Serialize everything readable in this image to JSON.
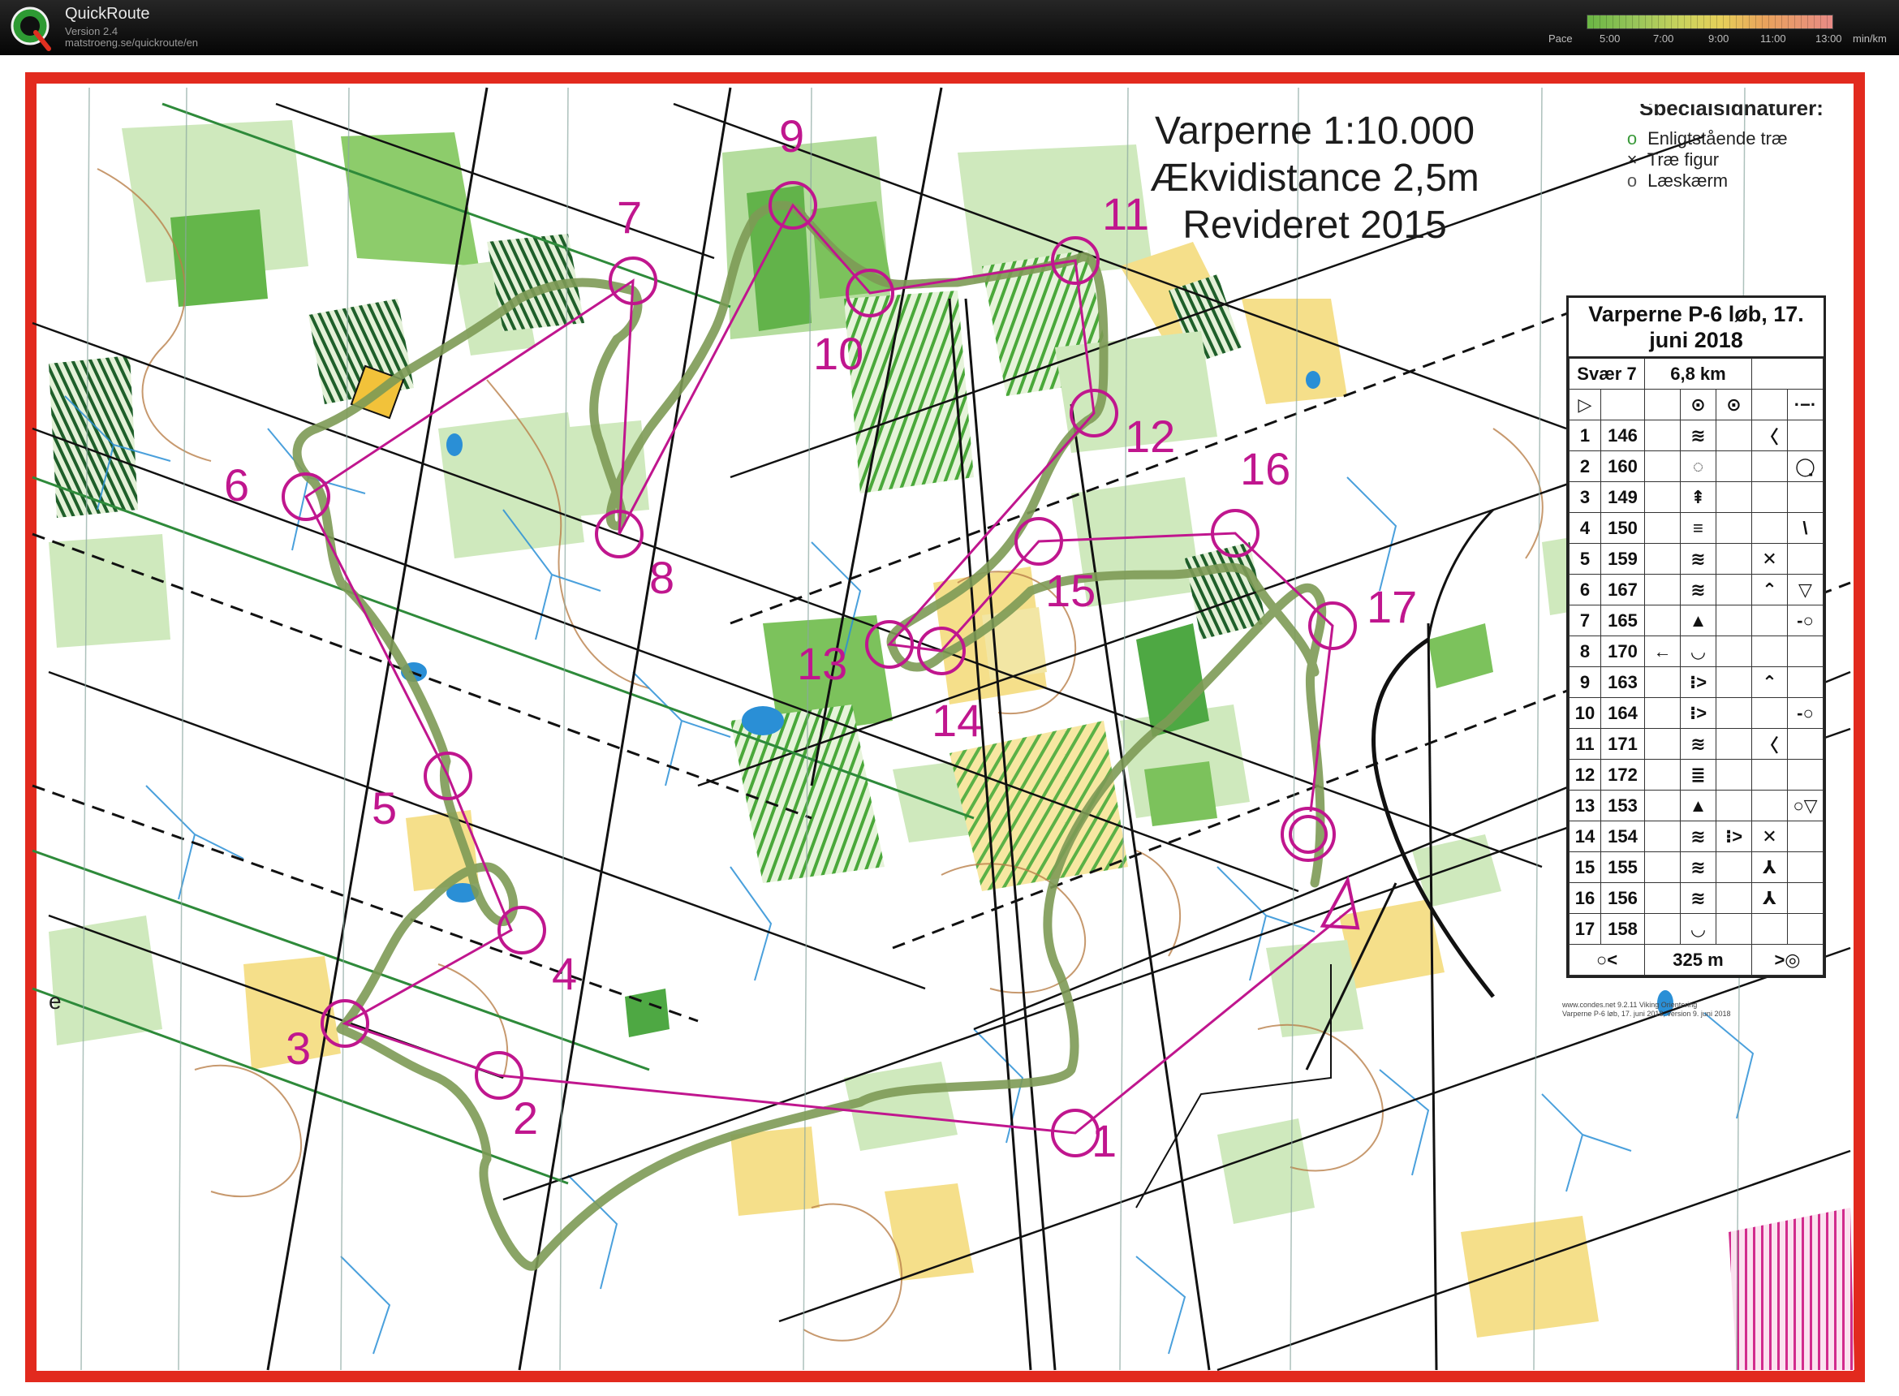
{
  "app": {
    "name": "QuickRoute",
    "version": "Version 2.4",
    "url": "matstroeng.se/quickroute/en"
  },
  "pace": {
    "label": "Pace",
    "ticks": [
      "5:00",
      "7:00",
      "9:00",
      "11:00",
      "13:00"
    ],
    "unit": "min/km"
  },
  "map": {
    "title_lines": [
      "Varperne 1:10.000",
      "Ækvidistance 2,5m",
      "Revideret 2015"
    ],
    "legend_heading": "Specialsignaturer:",
    "legend_items": [
      {
        "symbol": "o",
        "label": "Enligtstående træ"
      },
      {
        "symbol": "×",
        "label": "Træ figur"
      },
      {
        "symbol": "o",
        "label": "Læskærm"
      }
    ],
    "corner_mark": "e",
    "controls": [
      {
        "label": "1"
      },
      {
        "label": "2"
      },
      {
        "label": "3"
      },
      {
        "label": "4"
      },
      {
        "label": "5"
      },
      {
        "label": "6"
      },
      {
        "label": "7"
      },
      {
        "label": "8"
      },
      {
        "label": "9"
      },
      {
        "label": "10"
      },
      {
        "label": "11"
      },
      {
        "label": "12"
      },
      {
        "label": "13"
      },
      {
        "label": "14"
      },
      {
        "label": "15"
      },
      {
        "label": "16"
      },
      {
        "label": "17"
      }
    ],
    "colors": {
      "course": "#c0168e",
      "route": "#8aa65a",
      "frame": "#e22a1e",
      "forest_green": "#7cc25c",
      "light_green": "#cfe9bd",
      "yellow": "#f5df8a",
      "contour": "#b9804a",
      "water": "#2a8fd6",
      "path": "#111111"
    }
  },
  "descriptions": {
    "title": "Varperne P-6 løb, 17. juni 2018",
    "class": "Svær 7",
    "length": "6,8 km",
    "start_row": {
      "num": "▷",
      "code": "",
      "sym": [
        "",
        "⊙",
        "⊙",
        "",
        "·−·"
      ]
    },
    "rows": [
      {
        "num": "1",
        "code": "146",
        "sym": [
          "",
          "≋",
          "",
          "〈",
          ""
        ]
      },
      {
        "num": "2",
        "code": "160",
        "sym": [
          "",
          "◌",
          "",
          "",
          "◯̣"
        ]
      },
      {
        "num": "3",
        "code": "149",
        "sym": [
          "",
          "⇞",
          "",
          "",
          ""
        ]
      },
      {
        "num": "4",
        "code": "150",
        "sym": [
          "",
          "≡",
          "",
          "",
          "\\"
        ]
      },
      {
        "num": "5",
        "code": "159",
        "sym": [
          "",
          "≋",
          "",
          "✕",
          ""
        ]
      },
      {
        "num": "6",
        "code": "167",
        "sym": [
          "",
          "≋",
          "",
          "⌃",
          "▽"
        ]
      },
      {
        "num": "7",
        "code": "165",
        "sym": [
          "",
          "▲",
          "",
          "",
          "-○"
        ]
      },
      {
        "num": "8",
        "code": "170",
        "sym": [
          "←",
          "◡",
          "",
          "",
          ""
        ]
      },
      {
        "num": "9",
        "code": "163",
        "sym": [
          "",
          "⁝>",
          "",
          "⌃",
          ""
        ]
      },
      {
        "num": "10",
        "code": "164",
        "sym": [
          "",
          "⁝>",
          "",
          "",
          "-○"
        ]
      },
      {
        "num": "11",
        "code": "171",
        "sym": [
          "",
          "≋",
          "",
          "〈",
          ""
        ]
      },
      {
        "num": "12",
        "code": "172",
        "sym": [
          "",
          "≣",
          "",
          "",
          ""
        ]
      },
      {
        "num": "13",
        "code": "153",
        "sym": [
          "",
          "▲",
          "",
          "",
          "○▽"
        ]
      },
      {
        "num": "14",
        "code": "154",
        "sym": [
          "",
          "≋",
          "⁝>",
          "✕",
          ""
        ]
      },
      {
        "num": "15",
        "code": "155",
        "sym": [
          "",
          "≋",
          "",
          "⅄",
          ""
        ]
      },
      {
        "num": "16",
        "code": "156",
        "sym": [
          "",
          "≋",
          "",
          "⅄",
          ""
        ]
      },
      {
        "num": "17",
        "code": "158",
        "sym": [
          "",
          "◡",
          "",
          "",
          ""
        ]
      }
    ],
    "finish": {
      "left": "○<",
      "distance": "325 m",
      "right": ">◎"
    },
    "footer_lines": [
      "www.condes.net 9.2.11 Viking Orientering",
      "Varperne P-6 løb, 17. juni 2018, version 9. juni 2018"
    ]
  }
}
